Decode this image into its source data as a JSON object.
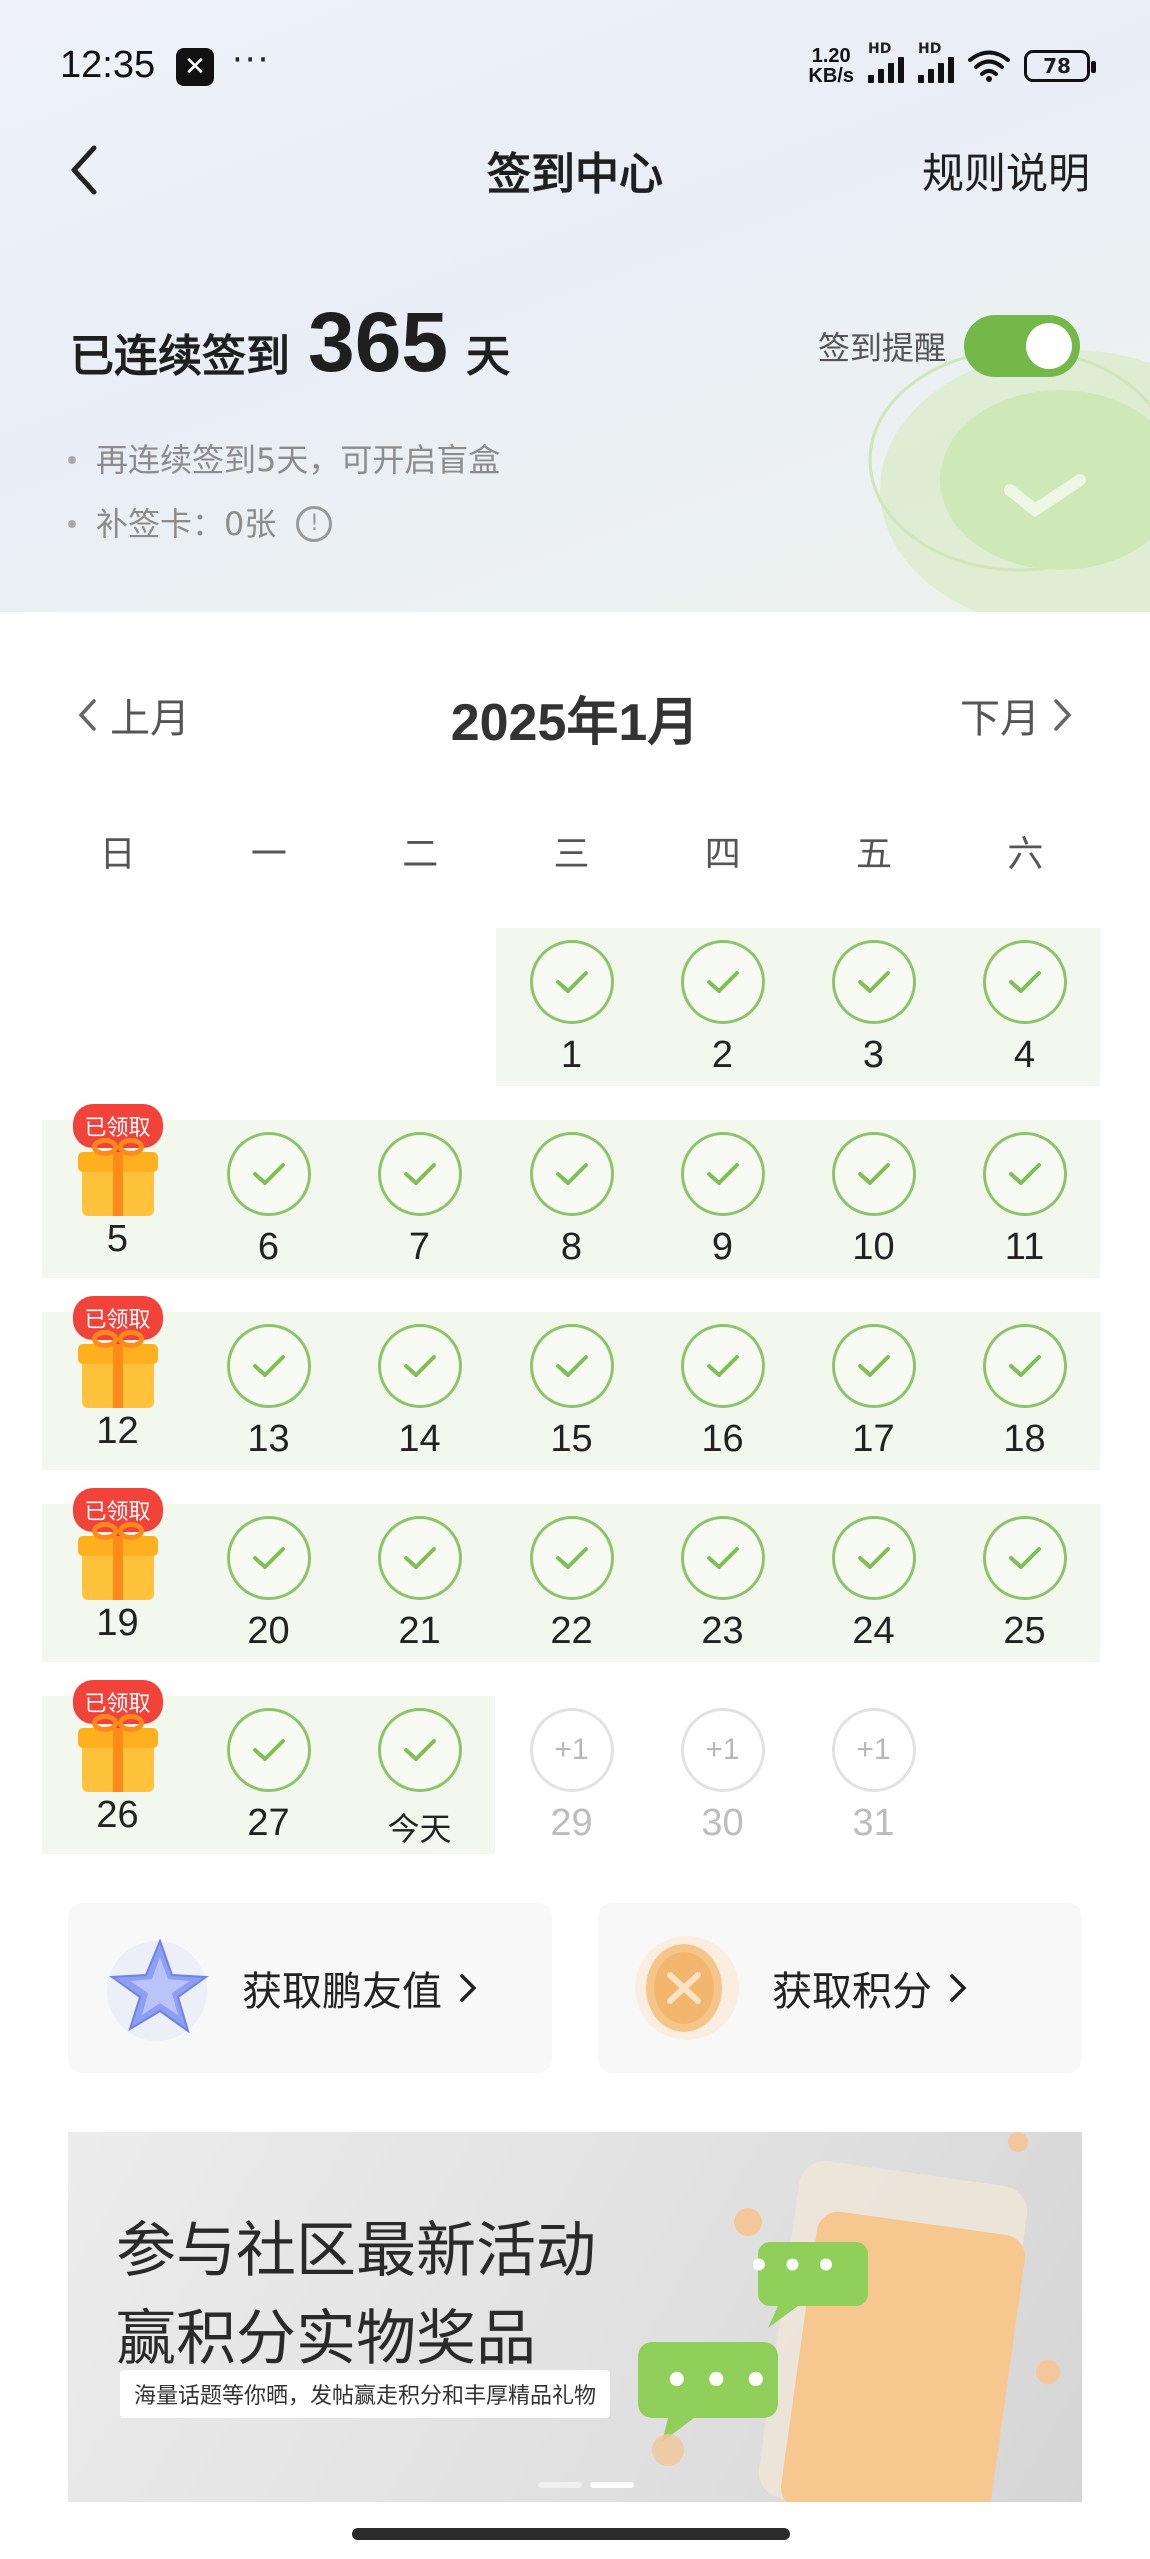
{
  "status_bar": {
    "time": "12:35",
    "app_icon_glyph": "✕",
    "overflow_dots": "···",
    "net_speed_value": "1.20",
    "net_speed_unit": "KB/s",
    "signal_label_1": "HD",
    "signal_label_2": "HD",
    "battery": "78"
  },
  "nav": {
    "title": "签到中心",
    "rules_label": "规则说明"
  },
  "streak": {
    "prefix": "已连续签到",
    "days": "365",
    "unit": "天"
  },
  "reminder": {
    "label": "签到提醒",
    "enabled": true
  },
  "tips": [
    "再连续签到5天，可开启盲盒",
    "补签卡：0张"
  ],
  "info_icon_glyph": "!",
  "calendar": {
    "title": "2025年1月",
    "prev_label": "上月",
    "next_label": "下月",
    "weekdays": [
      "日",
      "一",
      "二",
      "三",
      "四",
      "五",
      "六"
    ],
    "claimed_badge": "已领取",
    "plus_label": "+1",
    "today_label": "今天",
    "days": {
      "1": "1",
      "2": "2",
      "3": "3",
      "4": "4",
      "5": "5",
      "6": "6",
      "7": "7",
      "8": "8",
      "9": "9",
      "10": "10",
      "11": "11",
      "12": "12",
      "13": "13",
      "14": "14",
      "15": "15",
      "16": "16",
      "17": "17",
      "18": "18",
      "19": "19",
      "20": "20",
      "21": "21",
      "22": "22",
      "23": "23",
      "24": "24",
      "25": "25",
      "26": "26",
      "27": "27",
      "29": "29",
      "30": "30",
      "31": "31"
    }
  },
  "cards": {
    "left_label": "获取鹏友值",
    "right_label": "获取积分"
  },
  "banner": {
    "line1": "参与社区最新活动",
    "line2": "赢积分实物奖品",
    "subtitle": "海量话题等你晒，发帖赢走积分和丰厚精品礼物",
    "bubble_text": "• • •"
  },
  "colors": {
    "accent_green": "#74b84a",
    "check_green": "#8cc46a",
    "band_green": "#f3f8ee",
    "badge_red": "#f0443b",
    "gift_orange": "#ffb01f"
  },
  "icons": [
    "back-icon",
    "chevron-left-icon",
    "chevron-right-icon",
    "check-icon",
    "gift-icon",
    "info-icon",
    "star-gem-icon",
    "coin-icon",
    "wifi-icon",
    "signal-icon",
    "battery-icon"
  ]
}
